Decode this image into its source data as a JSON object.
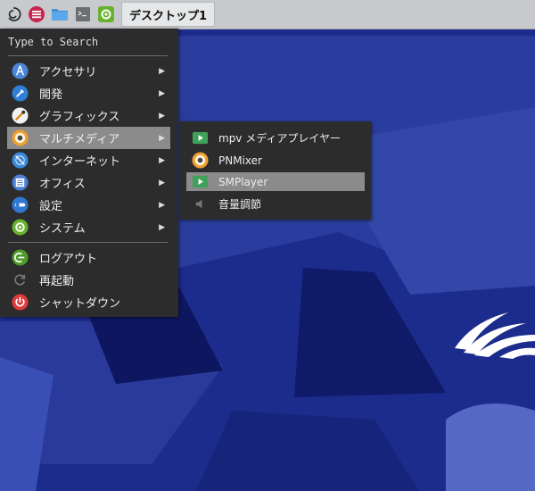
{
  "taskbar": {
    "icons": [
      "debian-logo-icon",
      "menu-icon",
      "folder-icon",
      "terminal-icon",
      "settings-icon"
    ],
    "task_title": "デスクトップ1"
  },
  "main_menu": {
    "search_placeholder": "Type to Search",
    "categories": [
      {
        "label": "アクセサリ",
        "icon": "accessories-icon",
        "has_submenu": true
      },
      {
        "label": "開発",
        "icon": "development-icon",
        "has_submenu": true
      },
      {
        "label": "グラフィックス",
        "icon": "graphics-icon",
        "has_submenu": true
      },
      {
        "label": "マルチメディア",
        "icon": "multimedia-icon",
        "has_submenu": true,
        "active": true
      },
      {
        "label": "インターネット",
        "icon": "internet-icon",
        "has_submenu": true
      },
      {
        "label": "オフィス",
        "icon": "office-icon",
        "has_submenu": true
      },
      {
        "label": "設定",
        "icon": "settings-icon",
        "has_submenu": true
      },
      {
        "label": "システム",
        "icon": "system-icon",
        "has_submenu": true
      }
    ],
    "session": [
      {
        "label": "ログアウト",
        "icon": "logout-icon"
      },
      {
        "label": "再起動",
        "icon": "reboot-icon"
      },
      {
        "label": "シャットダウン",
        "icon": "shutdown-icon"
      }
    ]
  },
  "sub_menu": {
    "items": [
      {
        "label": "mpv メディアプレイヤー",
        "icon": "media-player-icon"
      },
      {
        "label": "PNMixer",
        "icon": "mixer-icon"
      },
      {
        "label": "SMPlayer",
        "icon": "media-player-icon",
        "active": true
      },
      {
        "label": "音量調節",
        "icon": "volume-icon"
      }
    ]
  },
  "colors": {
    "desktop_bg": "#1d2e8e",
    "menu_bg": "#2c2c2c",
    "highlight": "#8b8b8b",
    "taskbar_bg": "#c7c9cc"
  }
}
